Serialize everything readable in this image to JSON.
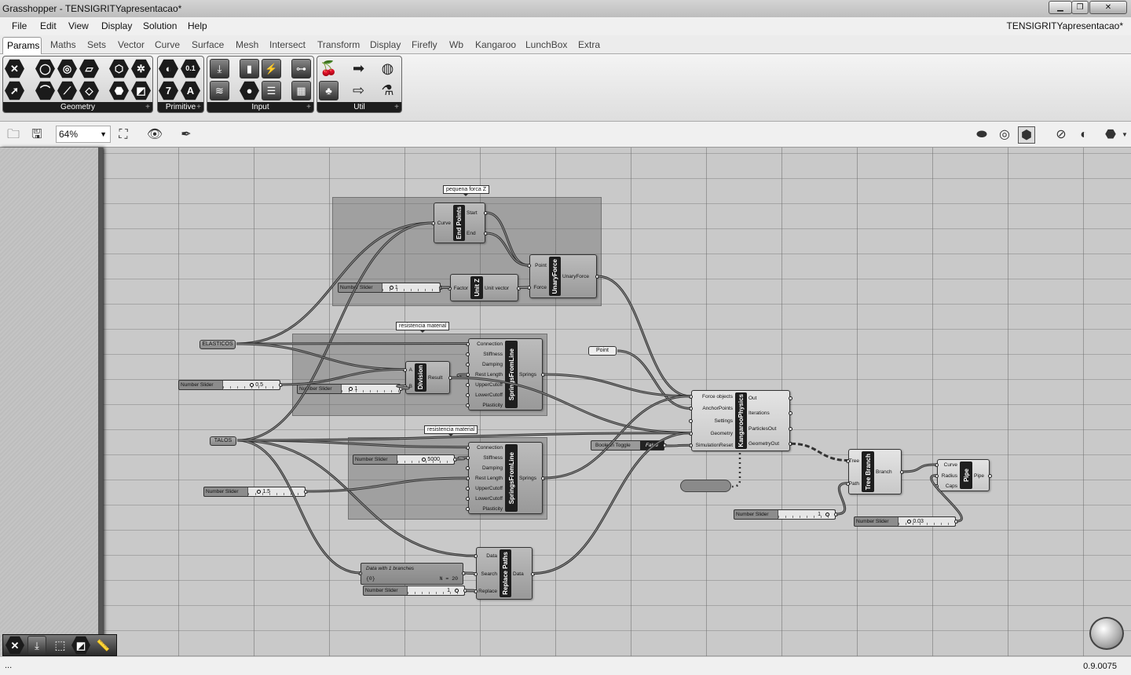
{
  "window": {
    "title": "Grasshopper - TENSIGRITYapresentacao*",
    "document": "TENSIGRITYapresentacao*",
    "buttons": {
      "minimize": "▁",
      "maximize": "❐",
      "close": "✕"
    }
  },
  "menu": [
    "File",
    "Edit",
    "View",
    "Display",
    "Solution",
    "Help"
  ],
  "tabs": [
    "Params",
    "Maths",
    "Sets",
    "Vector",
    "Curve",
    "Surface",
    "Mesh",
    "Intersect",
    "Transform",
    "Display",
    "Firefly",
    "Wb",
    "Kangaroo",
    "LunchBox",
    "Extra"
  ],
  "ribbon_panels": [
    "Geometry",
    "Primitive",
    "Input",
    "Util"
  ],
  "toolbar": {
    "zoom": "64%"
  },
  "groups": [
    "pequena forca Z",
    "resistencia material",
    "resistencia material"
  ],
  "params": {
    "elasticos": "ELASTICOS",
    "talos": "TALOS",
    "point": "Point"
  },
  "components": {
    "end_points": {
      "name": "End Points",
      "inputs": [
        "Curve"
      ],
      "outputs": [
        "Start",
        "End"
      ]
    },
    "unary_force": {
      "name": "UnaryForce",
      "inputs": [
        "Point",
        "Force"
      ],
      "outputs": [
        "UnaryForce"
      ]
    },
    "unit_z": {
      "name": "Unit Z",
      "inputs": [
        "Factor"
      ],
      "outputs": [
        "Unit vector"
      ]
    },
    "division": {
      "name": "Division",
      "inputs": [
        "A",
        "B"
      ],
      "outputs": [
        "Result"
      ]
    },
    "springs1": {
      "name": "SpringsFromLine",
      "inputs": [
        "Connection",
        "Stiffness",
        "Damping",
        "Rest Length",
        "UpperCutoff",
        "LowerCutoff",
        "Plasticity"
      ],
      "outputs": [
        "Springs"
      ]
    },
    "springs2": {
      "name": "SpringsFromLine",
      "inputs": [
        "Connection",
        "Stiffness",
        "Damping",
        "Rest Length",
        "UpperCutoff",
        "LowerCutoff",
        "Plasticity"
      ],
      "outputs": [
        "Springs"
      ]
    },
    "kangaroo": {
      "name": "KangarooPhysics",
      "inputs": [
        "Force objects",
        "AnchorPoints",
        "Settings",
        "Geometry",
        "SimulationReset"
      ],
      "outputs": [
        "Out",
        "Iterations",
        "ParticlesOut",
        "GeometryOut"
      ]
    },
    "replace_paths": {
      "name": "Replace Paths",
      "inputs": [
        "Data",
        "Search",
        "Replace"
      ],
      "outputs": [
        "Data"
      ]
    },
    "tree_branch": {
      "name": "Tree Branch",
      "inputs": [
        "Tree",
        "Path"
      ],
      "outputs": [
        "Branch"
      ]
    },
    "pipe": {
      "name": "Pipe",
      "inputs": [
        "Curve",
        "Radius",
        "Caps"
      ],
      "outputs": [
        "Pipe"
      ]
    }
  },
  "sliders": [
    {
      "label": "Number Slider",
      "value": "1"
    },
    {
      "label": "Number Slider",
      "value": "0.5"
    },
    {
      "label": "Number Slider",
      "value": "1"
    },
    {
      "label": "Number Slider",
      "value": "5000"
    },
    {
      "label": "Number Slider",
      "value": "1.5"
    },
    {
      "label": "Number Slider",
      "value": "1"
    },
    {
      "label": "Number Slider",
      "value": "1"
    },
    {
      "label": "Number Slider",
      "value": "0.03"
    }
  ],
  "toggle": {
    "label": "Boolean Toggle",
    "value": "False"
  },
  "panel": {
    "title": "Data with 1 branches",
    "path": "{0}",
    "count": "N = 20"
  },
  "status": {
    "left": "...",
    "version": "0.9.0075"
  }
}
